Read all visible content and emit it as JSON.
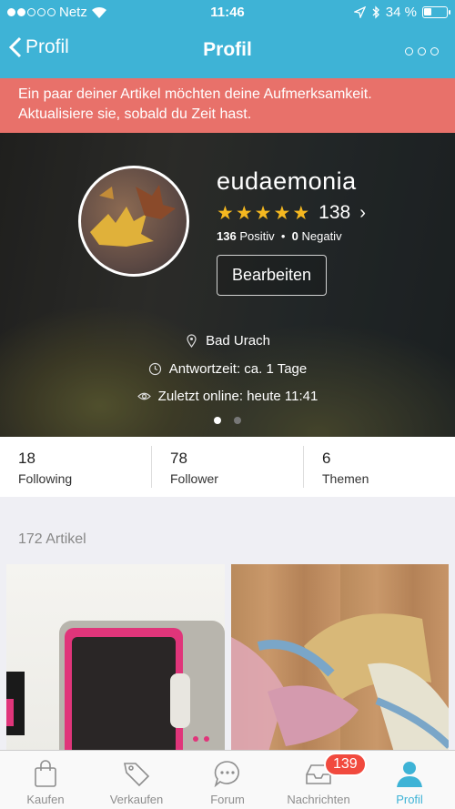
{
  "status": {
    "carrier": "Netz",
    "time": "11:46",
    "battery": "34 %"
  },
  "nav": {
    "back_label": "Profil",
    "title": "Profil"
  },
  "alert": {
    "text": "Ein paar deiner Artikel möchten deine Aufmerksamkeit. Aktualisiere sie, sobald du Zeit hast."
  },
  "profile": {
    "username": "eudaemonia",
    "rating_stars": 5,
    "rating_count": "138",
    "positive_count": "136",
    "positive_label": "Positiv",
    "negative_count": "0",
    "negative_label": "Negativ",
    "edit_label": "Bearbeiten",
    "location": "Bad Urach",
    "response_time": "Antwortzeit: ca. 1 Tage",
    "last_online": "Zuletzt online: heute 11:41"
  },
  "stats": [
    {
      "num": "18",
      "label": "Following"
    },
    {
      "num": "78",
      "label": "Follower"
    },
    {
      "num": "6",
      "label": "Themen"
    }
  ],
  "articles_title": "172 Artikel",
  "tabs": [
    {
      "label": "Kaufen",
      "icon": "bag-icon"
    },
    {
      "label": "Verkaufen",
      "icon": "tag-icon"
    },
    {
      "label": "Forum",
      "icon": "chat-icon"
    },
    {
      "label": "Nachrichten",
      "icon": "inbox-icon",
      "badge": "139"
    },
    {
      "label": "Profil",
      "icon": "person-icon"
    }
  ],
  "colors": {
    "accent": "#3eb3d6",
    "alert": "#e8716a",
    "star": "#f5b820",
    "badge": "#f14a3e"
  }
}
